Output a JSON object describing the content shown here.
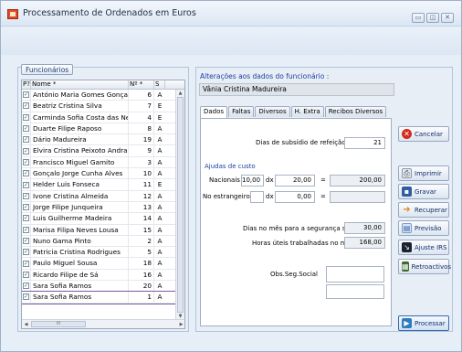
{
  "window": {
    "title": "Processamento de Ordenados em Euros"
  },
  "left": {
    "funcionarios_label": "Funcionários",
    "headers": [
      "P?",
      "Nome *",
      "Nº *",
      "S"
    ],
    "rows": [
      {
        "name": "António Maria Gomes Gonçalv",
        "num": "6",
        "s": "A",
        "checked": true
      },
      {
        "name": "Beatriz Cristina Silva",
        "num": "7",
        "s": "E",
        "checked": true
      },
      {
        "name": "Carminda Sofia Costa das Ne",
        "num": "4",
        "s": "E",
        "checked": true
      },
      {
        "name": "Duarte Filipe Raposo",
        "num": "8",
        "s": "A",
        "checked": true
      },
      {
        "name": "Dário Madureira",
        "num": "19",
        "s": "A",
        "checked": true
      },
      {
        "name": "Elvira Cristina Peixoto Andrac",
        "num": "9",
        "s": "A",
        "checked": true
      },
      {
        "name": "Francisco Miguel Gamito",
        "num": "3",
        "s": "A",
        "checked": true
      },
      {
        "name": "Gonçalo Jorge Cunha Alves",
        "num": "10",
        "s": "A",
        "checked": true
      },
      {
        "name": "Helder Luis Fonseca",
        "num": "11",
        "s": "E",
        "checked": true
      },
      {
        "name": "Ivone Cristina Almeida",
        "num": "12",
        "s": "A",
        "checked": true
      },
      {
        "name": "Jorge Filipe Junqueira",
        "num": "13",
        "s": "A",
        "checked": true
      },
      {
        "name": "Luis Guilherme Madeira",
        "num": "14",
        "s": "A",
        "checked": true
      },
      {
        "name": "Marisa Filipa Neves Lousa",
        "num": "15",
        "s": "A",
        "checked": true
      },
      {
        "name": "Nuno Gama Pinto",
        "num": "2",
        "s": "A",
        "checked": true
      },
      {
        "name": "Patricia Cristina Rodrigues",
        "num": "5",
        "s": "A",
        "checked": true
      },
      {
        "name": "Paulo Miguel Sousa",
        "num": "18",
        "s": "A",
        "checked": true
      },
      {
        "name": "Ricardo Filipe de Sá",
        "num": "16",
        "s": "A",
        "checked": true
      },
      {
        "name": "Sara Sofia Ramos",
        "num": "20",
        "s": "A",
        "checked": true
      },
      {
        "name": "Sara Sofia Ramos",
        "num": "1",
        "s": "A",
        "checked": true
      }
    ],
    "hscroll_thumb": "III"
  },
  "right": {
    "section_label": "Alterações aos dados do funcionário :",
    "employee_name": "Vânia Cristina Madureira",
    "tabs": [
      "Dados",
      "Faltas",
      "Diversos",
      "H. Extra",
      "Recibos Diversos"
    ],
    "dias_subsidio_label": "Dias de subsídio de refeição",
    "dias_subsidio_value": "21",
    "ajudas_label": "Ajudas de custo",
    "nacionais_label": "Nacionais",
    "nacionais_qty": "10,00",
    "dx1": "dx",
    "nacionais_rate": "20,00",
    "eq1": "=",
    "nacionais_total": "200,00",
    "estrangeiro_label": "No estrangeiro",
    "dx2": "dx",
    "estrangeiro_rate": "0,00",
    "eq2": "=",
    "dias_mes_label": "Dias no mês para a segurança social",
    "dias_mes_value": "30,00",
    "horas_label": "Horas úteis trabalhadas no mês",
    "horas_value": "168,00",
    "obs_label": "Obs.Seg.Social"
  },
  "buttons": {
    "cancelar": "Cancelar",
    "imprimir": "Imprimir",
    "gravar": "Gravar",
    "recuperar": "Recuperar",
    "previsao": "Previsão",
    "ajuste": "Ajuste IRS",
    "retroactivos": "Retroactivos",
    "processar": "Processar"
  },
  "window_buttons": {
    "min": "▭",
    "max": "◫",
    "close": "✕"
  }
}
